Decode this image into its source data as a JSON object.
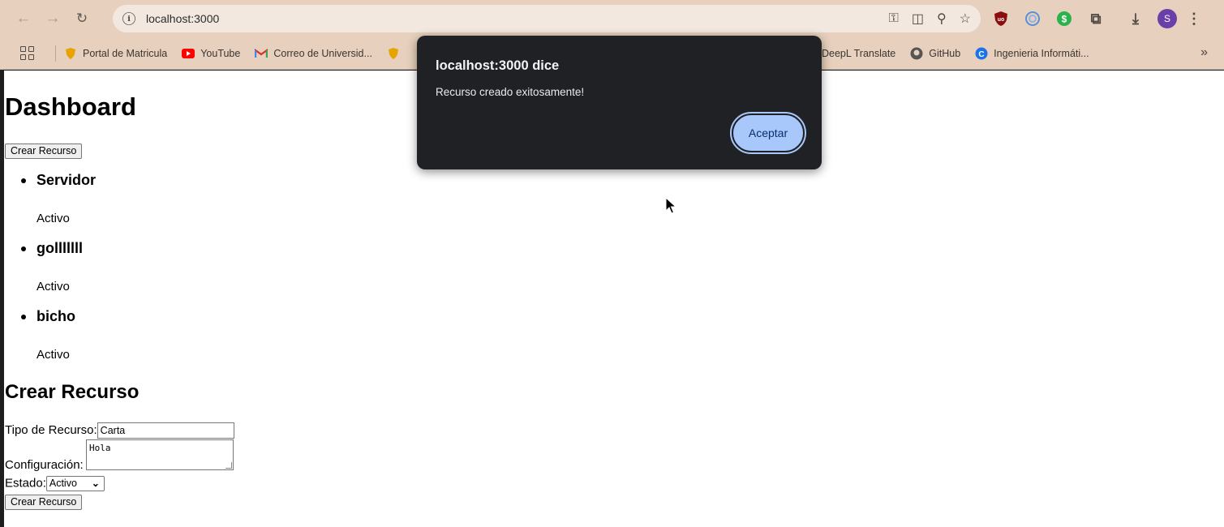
{
  "browser": {
    "url": "localhost:3000",
    "bookmarks": [
      {
        "label": "Portal de Matricula",
        "color": "#e6a400"
      },
      {
        "label": "YouTube",
        "color": "#ff0000"
      },
      {
        "label": "Correo de Universid...",
        "color": "#d93025"
      },
      {
        "label": "DeepL Translate",
        "color": "#0f2b46"
      },
      {
        "label": "GitHub",
        "color": "#555555"
      },
      {
        "label": "Ingenieria Informáti...",
        "color": "#1a73e8"
      }
    ],
    "avatar_letter": "S",
    "more_label": "»"
  },
  "page": {
    "title": "Dashboard",
    "create_button": "Crear Recurso",
    "resources": [
      {
        "name": "Servidor",
        "status": "Activo"
      },
      {
        "name": "golllllll",
        "status": "Activo"
      },
      {
        "name": "bicho",
        "status": "Activo"
      }
    ],
    "form": {
      "heading": "Crear Recurso",
      "type_label": "Tipo de Recurso:",
      "type_value": "Carta",
      "config_label": "Configuración:",
      "config_value": "Hola",
      "status_label": "Estado:",
      "status_value": "Activo",
      "submit": "Crear Recurso"
    }
  },
  "dialog": {
    "title": "localhost:3000 dice",
    "message": "Recurso creado exitosamente!",
    "ok": "Aceptar"
  }
}
